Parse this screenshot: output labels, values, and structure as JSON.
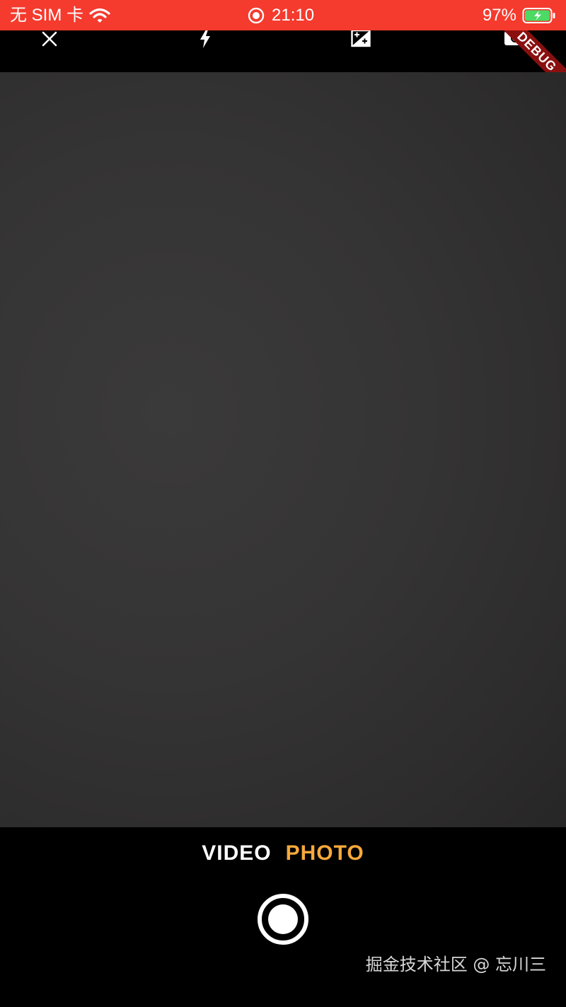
{
  "status_bar": {
    "carrier": "无 SIM 卡",
    "time": "21:10",
    "battery": "97%",
    "background_color": "#f53a2e",
    "icons": [
      "wifi-icon",
      "screen-record-icon",
      "battery-charging-icon"
    ]
  },
  "toolbar": {
    "icons": [
      "close-icon",
      "flash-icon",
      "exposure-icon",
      "switch-camera-icon"
    ],
    "debug_label": "DEBUG"
  },
  "modes": {
    "video": "VIDEO",
    "photo": "PHOTO",
    "active": "PHOTO",
    "active_color": "#f7a93b"
  },
  "shutter": {
    "icon": "shutter-icon"
  },
  "watermark": "掘金技术社区 @ 忘川三"
}
